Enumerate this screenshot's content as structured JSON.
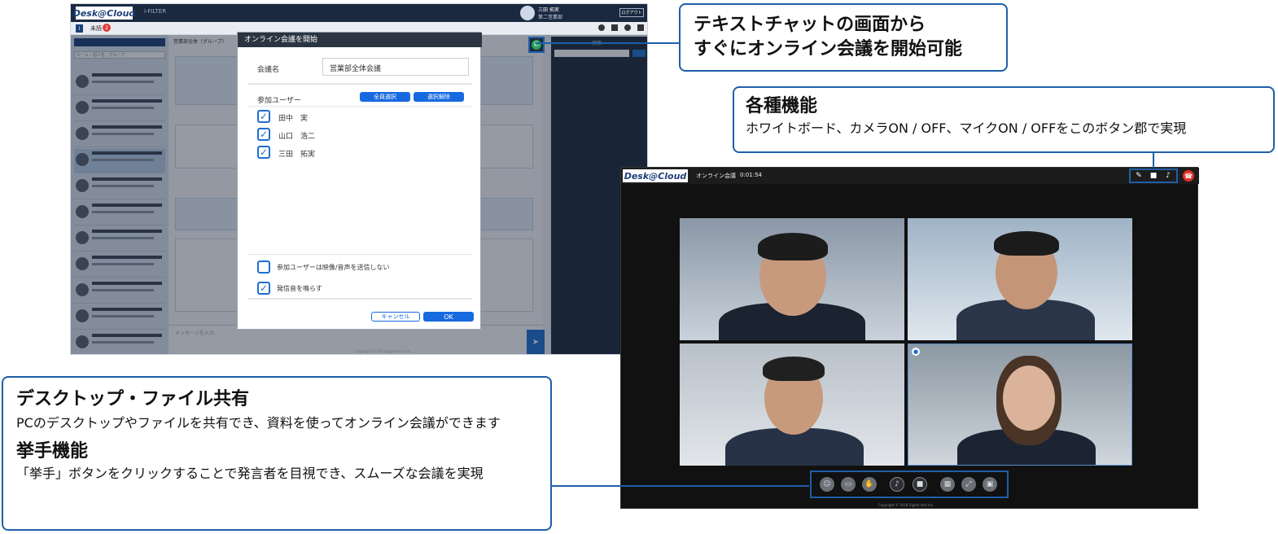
{
  "callouts": {
    "text_chat": {
      "line1": "テキストチャットの画面から",
      "line2": "すぐにオンライン会議を開始可能"
    },
    "features": {
      "title": "各種機能",
      "body": "ホワイトボード、カメラON / OFF、マイクON / OFFをこのボタン郡で実現"
    },
    "desktop_share": {
      "title": "デスクトップ・ファイル共有",
      "body": "PCのデスクトップやファイルを共有でき、資料を使ってオンライン会議ができます"
    },
    "raise_hand": {
      "title": "挙手機能",
      "body": "「挙手」ボタンをクリックすることで発言者を目視でき、スムーズな会議を実現"
    }
  },
  "chat_app": {
    "logo": "Desk@Cloud",
    "filter_tab": "i-FILTER",
    "unread_label": "未読",
    "unread_count": "2",
    "user": {
      "name": "三田 拓実",
      "dept": "第二営業部"
    },
    "logout_label": "ログアウト",
    "search_placeholder": "ルーム・個人名・グループ",
    "room_header": "営業部全体（グループ）",
    "message_placeholder": "メッセージを入力...",
    "copyright": "Copyright © 2018 Digital Arts Inc.",
    "right_panel_title": "検索"
  },
  "dialog": {
    "title": "オンライン会議を開始",
    "meeting_name_label": "会議名",
    "meeting_name_value": "営業部全体会議",
    "participants_label": "参加ユーザー",
    "select_all_label": "全員選択",
    "deselect_label": "選択解除",
    "participants": [
      {
        "name": "田中　実",
        "checked": true
      },
      {
        "name": "山口　浩二",
        "checked": true
      },
      {
        "name": "三田　拓実",
        "checked": true
      }
    ],
    "no_send_option": "参加ユーザーは映像/音声を送信しない",
    "no_send_checked": false,
    "ring_option": "発信音を鳴らす",
    "ring_checked": true,
    "cancel_label": "キャンセル",
    "ok_label": "OK"
  },
  "conference": {
    "logo": "Desk@Cloud",
    "title": "オンライン会議",
    "elapsed": "0:01:54",
    "copyright": "Copyright © 2018 Digital Arts Inc.",
    "toolbar_icons": [
      "participants-icon",
      "screen-share-icon",
      "raise-hand-icon",
      "mic-icon",
      "camera-icon",
      "layout-icon",
      "fullscreen-icon",
      "whiteboard-icon"
    ],
    "top_icons": [
      "whiteboard-icon",
      "camera-icon",
      "mic-icon",
      "hangup-icon"
    ]
  },
  "colors": {
    "accent": "#1f5fa8",
    "button_blue": "#1769e0",
    "hangup": "#e0302a",
    "badge": "#e23b3b"
  }
}
